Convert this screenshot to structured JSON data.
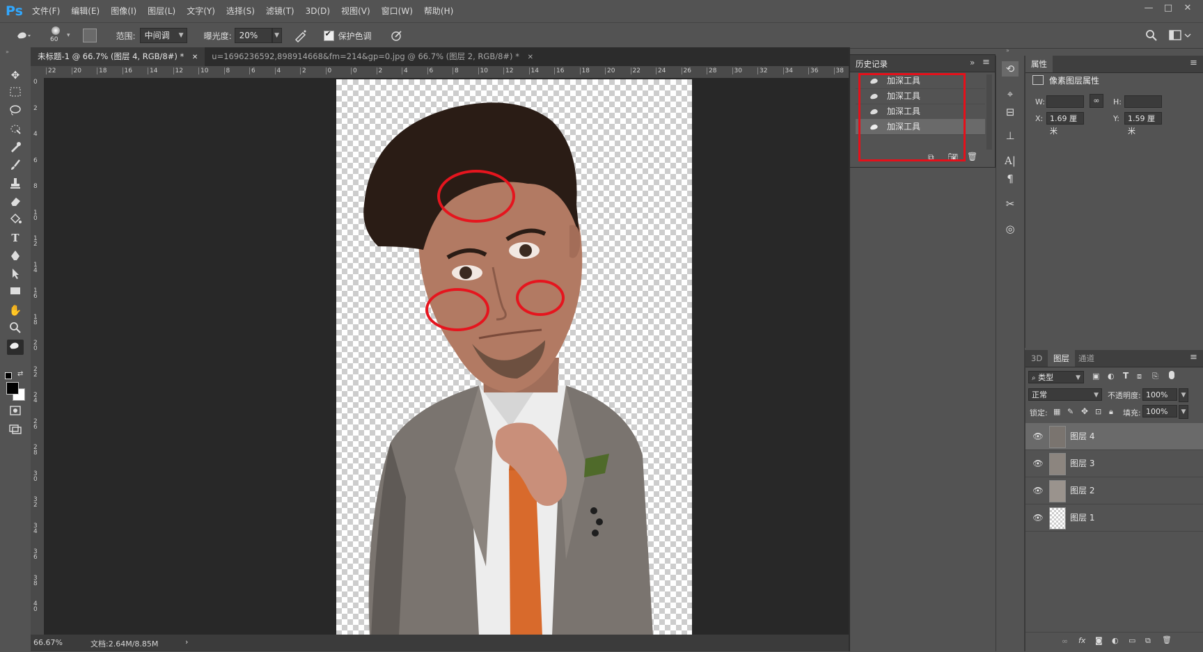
{
  "app": {
    "logo": "Ps"
  },
  "menu": [
    "文件(F)",
    "编辑(E)",
    "图像(I)",
    "图层(L)",
    "文字(Y)",
    "选择(S)",
    "滤镜(T)",
    "3D(D)",
    "视图(V)",
    "窗口(W)",
    "帮助(H)"
  ],
  "window_controls": {
    "minimize": "—",
    "maximize": "□",
    "close": "✕"
  },
  "options": {
    "brush_size": "60",
    "range_label": "范围:",
    "range_value": "中间调",
    "exposure_label": "曝光度:",
    "exposure_value": "20%",
    "protect_tones_label": "保护色调",
    "protect_tones_checked": true
  },
  "tabs": [
    {
      "label": "未标题-1 @ 66.7% (图层 4, RGB/8#) *",
      "close": "✕",
      "active": true
    },
    {
      "label": "u=1696236592,898914668&fm=214&gp=0.jpg @ 66.7% (图层 2, RGB/8#) *",
      "close": "✕",
      "active": false
    }
  ],
  "ruler_h": [
    "22",
    "20",
    "18",
    "16",
    "14",
    "12",
    "10",
    "8",
    "6",
    "4",
    "2",
    "0",
    "0",
    "2",
    "4",
    "6",
    "8",
    "10",
    "12",
    "14",
    "16",
    "18",
    "20",
    "22",
    "24",
    "26",
    "28",
    "30",
    "32",
    "34",
    "36",
    "38"
  ],
  "ruler_v": [
    "0",
    "2",
    "4",
    "6",
    "8",
    "1 0",
    "1 2",
    "1 4",
    "1 6",
    "1 8",
    "2 0",
    "2 2",
    "2 4",
    "2 6",
    "2 8",
    "3 0",
    "3 2",
    "3 4",
    "3 6",
    "3 8",
    "4 0"
  ],
  "status": {
    "zoom": "66.67%",
    "doc": "文档:2.64M/8.85M",
    "arrow": "›"
  },
  "history": {
    "title": "历史记录",
    "expand": "»",
    "menu_icon": "≡",
    "items": [
      "加深工具",
      "加深工具",
      "加深工具",
      "加深工具"
    ]
  },
  "properties": {
    "title": "属性",
    "subtitle": "像素图层属性",
    "w_label": "W:",
    "w_value": "",
    "h_label": "H:",
    "h_value": "",
    "x_label": "X:",
    "x_value": "1.69 厘米",
    "y_label": "Y:",
    "y_value": "1.59 厘米"
  },
  "layers": {
    "tabs": [
      "3D",
      "图层",
      "通道"
    ],
    "filter_label": "类型",
    "blend_mode": "正常",
    "opacity_label": "不透明度:",
    "opacity_value": "100%",
    "lock_label": "锁定:",
    "fill_label": "填充:",
    "fill_value": "100%",
    "items": [
      {
        "name": "图层 4",
        "selected": true
      },
      {
        "name": "图层 3",
        "selected": false
      },
      {
        "name": "图层 2",
        "selected": false
      },
      {
        "name": "图层 1",
        "selected": false
      }
    ]
  },
  "colors": {
    "annotation": "#e5101a",
    "accent": "#31a8ff"
  }
}
